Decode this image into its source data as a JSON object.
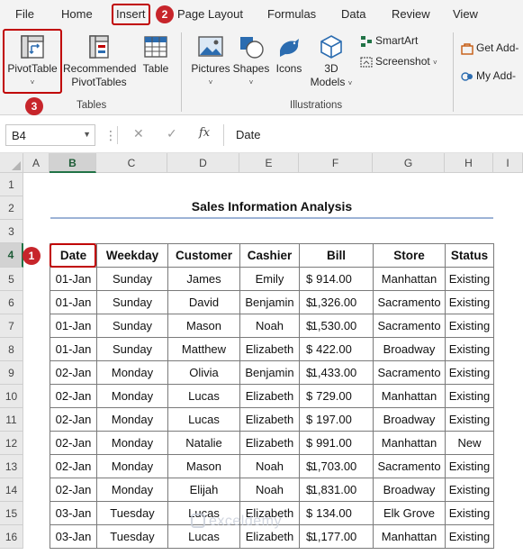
{
  "tabs": [
    "File",
    "Home",
    "Insert",
    "Page Layout",
    "Formulas",
    "Data",
    "Review",
    "View"
  ],
  "step_badges": [
    "1",
    "2",
    "3"
  ],
  "ribbon": {
    "tables": {
      "pivot_line1": "PivotTable",
      "pivot_caret": "˅",
      "recommended_line1": "Recommended",
      "recommended_line2": "PivotTables",
      "table": "Table",
      "group_label": "Tables"
    },
    "illustrations": {
      "pictures": "Pictures",
      "shapes": "Shapes",
      "icons": "Icons",
      "models_line1": "3D",
      "models_line2": "Models",
      "smartart": "SmartArt",
      "screenshot": "Screenshot",
      "group_label": "Illustrations"
    },
    "addins": {
      "get_addins": "Get Add-",
      "my_addins": "My Add-"
    }
  },
  "formula_bar": {
    "name_box": "B4",
    "content": "Date",
    "fx": "fx"
  },
  "columns": [
    "A",
    "B",
    "C",
    "D",
    "E",
    "F",
    "G",
    "H",
    "I"
  ],
  "rows": [
    "1",
    "2",
    "3",
    "4",
    "5",
    "6",
    "7",
    "8",
    "9",
    "10",
    "11",
    "12",
    "13",
    "14",
    "15",
    "16"
  ],
  "sheet": {
    "title": "Sales Information Analysis",
    "headers": [
      "Date",
      "Weekday",
      "Customer",
      "Cashier",
      "Bill",
      "Store",
      "Status"
    ],
    "currency_symbol": "$",
    "records": [
      [
        "01-Jan",
        "Sunday",
        "James",
        "Emily",
        "914.00",
        "Manhattan",
        "Existing"
      ],
      [
        "01-Jan",
        "Sunday",
        "David",
        "Benjamin",
        "1,326.00",
        "Sacramento",
        "Existing"
      ],
      [
        "01-Jan",
        "Sunday",
        "Mason",
        "Noah",
        "1,530.00",
        "Sacramento",
        "Existing"
      ],
      [
        "01-Jan",
        "Sunday",
        "Matthew",
        "Elizabeth",
        "422.00",
        "Broadway",
        "Existing"
      ],
      [
        "02-Jan",
        "Monday",
        "Olivia",
        "Benjamin",
        "1,433.00",
        "Sacramento",
        "Existing"
      ],
      [
        "02-Jan",
        "Monday",
        "Lucas",
        "Elizabeth",
        "729.00",
        "Manhattan",
        "Existing"
      ],
      [
        "02-Jan",
        "Monday",
        "Lucas",
        "Elizabeth",
        "197.00",
        "Broadway",
        "Existing"
      ],
      [
        "02-Jan",
        "Monday",
        "Natalie",
        "Elizabeth",
        "991.00",
        "Manhattan",
        "New"
      ],
      [
        "02-Jan",
        "Monday",
        "Mason",
        "Noah",
        "1,703.00",
        "Sacramento",
        "Existing"
      ],
      [
        "02-Jan",
        "Monday",
        "Elijah",
        "Noah",
        "1,831.00",
        "Broadway",
        "Existing"
      ],
      [
        "03-Jan",
        "Tuesday",
        "Lucas",
        "Elizabeth",
        "134.00",
        "Elk Grove",
        "Existing"
      ],
      [
        "03-Jan",
        "Tuesday",
        "Lucas",
        "Elizabeth",
        "1,177.00",
        "Manhattan",
        "Existing"
      ]
    ]
  },
  "watermark": "exceldemy"
}
